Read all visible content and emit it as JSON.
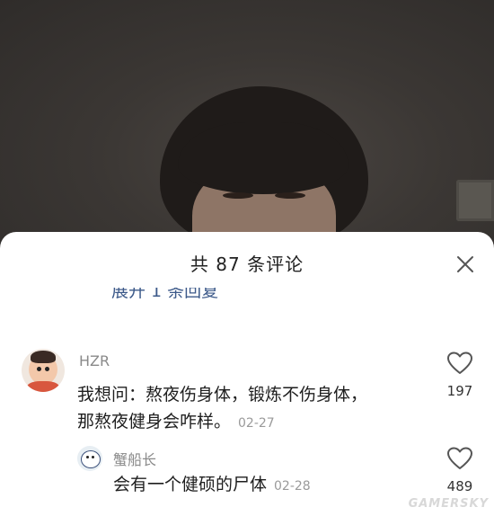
{
  "sheet": {
    "title": "共 87 条评论",
    "clipped_line": "展开 1 条回复"
  },
  "comments": [
    {
      "username": "HZR",
      "line1": "我想问：熬夜伤身体，锻炼不伤身体，",
      "line2": "那熬夜健身会咋样。",
      "date": "02-27",
      "likes": "197"
    }
  ],
  "reply": {
    "username": "蟹船长",
    "text": "会有一个健硕的尸体",
    "date": "02-28",
    "likes": "489"
  },
  "watermark": "GAMERSKY",
  "icons": {
    "close": "close-icon",
    "like": "heart-icon"
  }
}
